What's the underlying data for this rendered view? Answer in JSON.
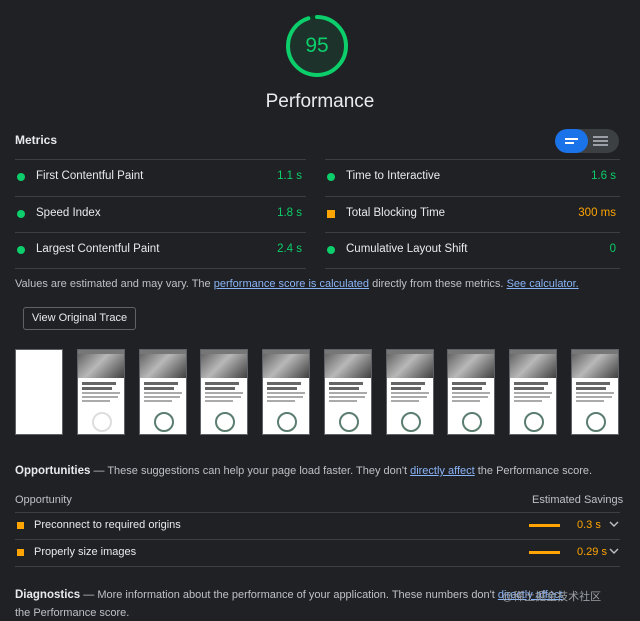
{
  "colors": {
    "pass": "#0cce6b",
    "average": "#ffa400",
    "link": "#8ab4f8",
    "accent": "#1a73e8"
  },
  "gauge": {
    "score": "95",
    "score_fraction": 0.95,
    "title": "Performance"
  },
  "metrics": {
    "header": "Metrics",
    "view_toggle": {
      "icons": [
        "list-view-icon",
        "table-view-icon"
      ],
      "active": "list-view-icon"
    },
    "left": [
      {
        "label": "First Contentful Paint",
        "value": "1.1 s",
        "rating": "pass"
      },
      {
        "label": "Speed Index",
        "value": "1.8 s",
        "rating": "pass"
      },
      {
        "label": "Largest Contentful Paint",
        "value": "2.4 s",
        "rating": "pass"
      }
    ],
    "right": [
      {
        "label": "Time to Interactive",
        "value": "1.6 s",
        "rating": "pass"
      },
      {
        "label": "Total Blocking Time",
        "value": "300 ms",
        "rating": "average"
      },
      {
        "label": "Cumulative Layout Shift",
        "value": "0",
        "rating": "pass"
      }
    ],
    "note": {
      "prefix": "Values are estimated and may vary. The ",
      "link1": "performance score is calculated",
      "middle": " directly from these metrics. ",
      "link2": "See calculator."
    }
  },
  "trace_button": "View Original Trace",
  "filmstrip": {
    "frames": [
      "blank",
      "loaded",
      "loaded",
      "loaded",
      "loaded",
      "loaded",
      "loaded",
      "loaded",
      "loaded",
      "loaded"
    ]
  },
  "opportunities": {
    "title": "Opportunities",
    "dash": " — ",
    "desc_prefix": "These suggestions can help your page load faster. They don't ",
    "desc_link": "directly affect",
    "desc_suffix": " the Performance score.",
    "col_opportunity": "Opportunity",
    "col_savings": "Estimated Savings",
    "items": [
      {
        "label": "Preconnect to required origins",
        "savings": "0.3 s",
        "icon": "chevron-down-icon"
      },
      {
        "label": "Properly size images",
        "savings": "0.29 s",
        "icon": "chevron-down-icon"
      }
    ]
  },
  "diagnostics": {
    "title": "Diagnostics",
    "dash": " — ",
    "desc_prefix": "More information about the performance of your application. These numbers don't ",
    "desc_link": "directly affect",
    "desc_suffix": " the Performance score."
  },
  "watermark": "@稀土掘金技术社区"
}
